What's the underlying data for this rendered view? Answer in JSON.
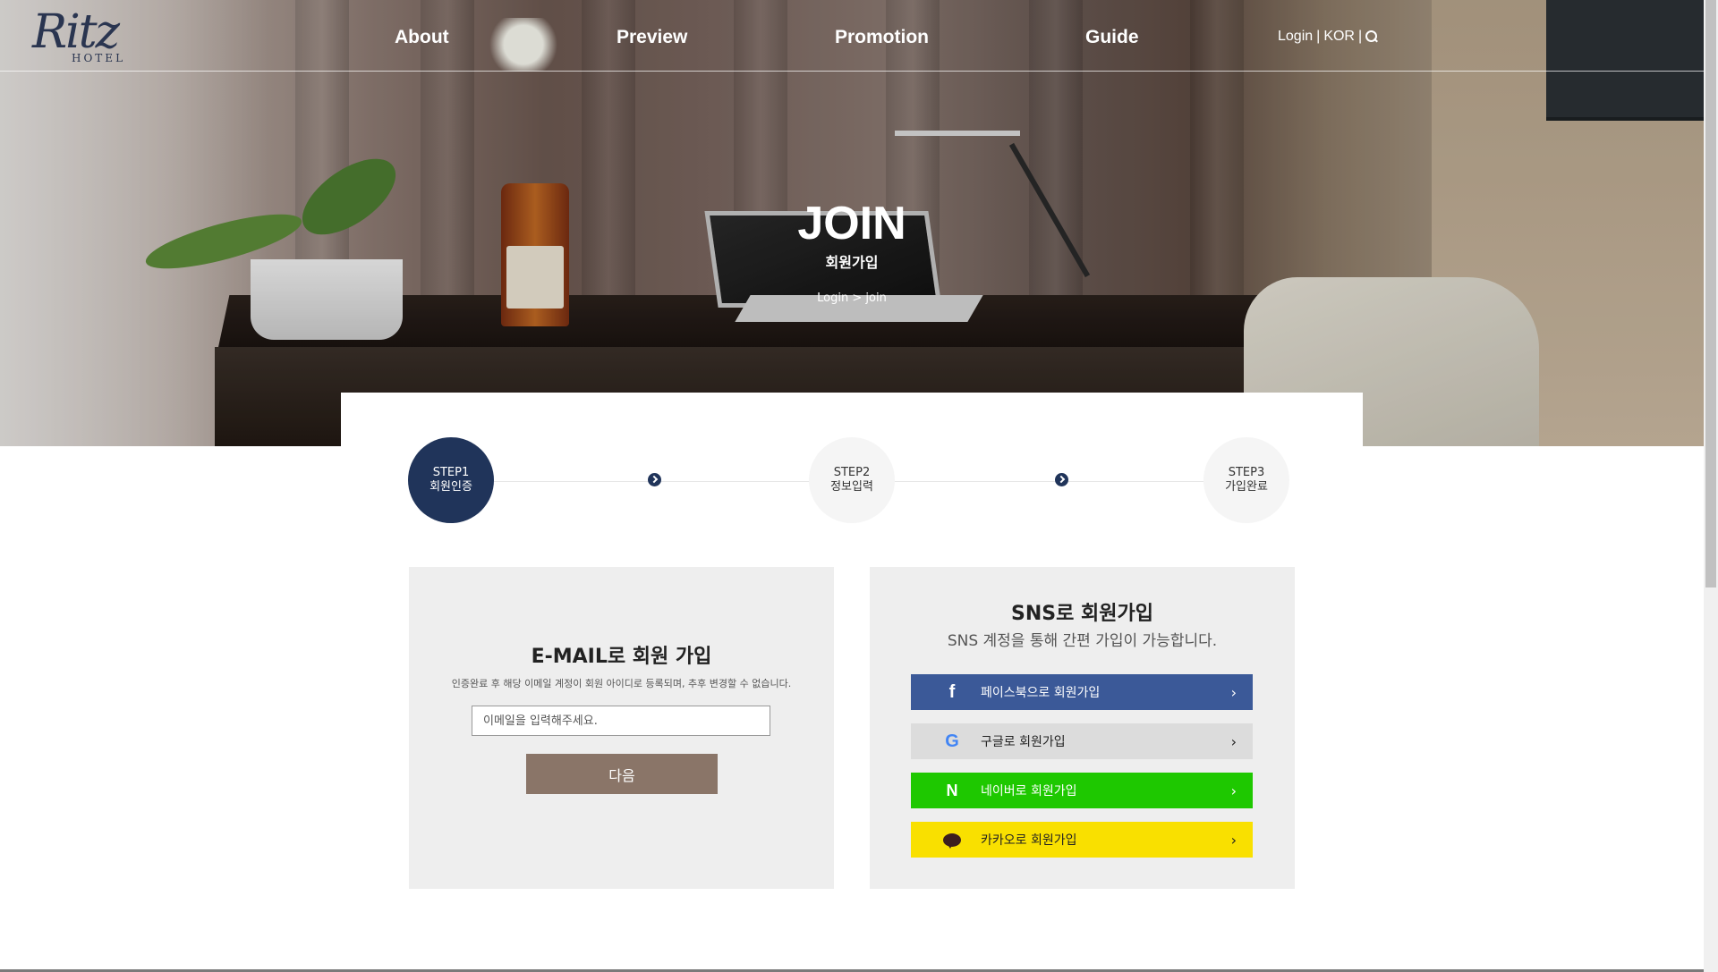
{
  "header": {
    "logo_script": "Ritz",
    "logo_sub": "HOTEL",
    "nav": [
      "About",
      "Preview",
      "Promotion",
      "Guide"
    ],
    "util": {
      "login": "Login",
      "sep1": "|",
      "lang": "KOR",
      "sep2": "|",
      "search_icon": "search-icon"
    }
  },
  "hero": {
    "title": "JOIN",
    "subtitle": "회원가입",
    "breadcrumb": "Login > join"
  },
  "steps": [
    {
      "label": "STEP1",
      "name": "회원인증",
      "active": true
    },
    {
      "label": "STEP2",
      "name": "정보입력",
      "active": false
    },
    {
      "label": "STEP3",
      "name": "가입완료",
      "active": false
    }
  ],
  "email": {
    "title": "E-MAIL로 회원 가입",
    "desc": "인증완료 후 해당 이메일 계정이 회원 아이디로 등록되며, 추후 변경할 수 없습니다.",
    "placeholder": "이메일을 입력해주세요.",
    "value": "",
    "next_label": "다음"
  },
  "sns": {
    "title": "SNS로 회원가입",
    "desc": "SNS 계정을 통해 간편 가입이 가능합니다.",
    "facebook": {
      "label": "페이스북으로 회원가입",
      "icon": "f",
      "color": "#3b5998"
    },
    "google": {
      "label": "구글로 회원가입",
      "icon": "G",
      "color": "#dcdcdc"
    },
    "naver": {
      "label": "네이버로 회원가입",
      "icon": "N",
      "color": "#1ec800"
    },
    "kakao": {
      "label": "카카오로 회원가입",
      "icon": "kakao-talk-icon",
      "color": "#f9e000"
    },
    "chevron": "›"
  },
  "colors": {
    "primary": "#20345a",
    "next_button": "#8a7568",
    "box_bg": "#eeeeee"
  }
}
